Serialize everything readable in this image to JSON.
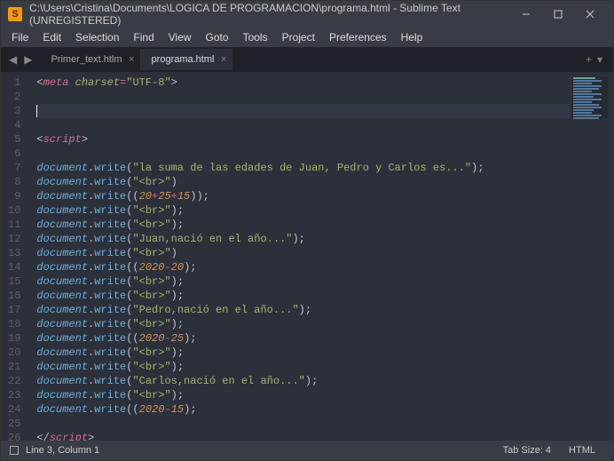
{
  "window": {
    "title": "C:\\Users\\Cristina\\Documents\\LOGICA DE PROGRAMACION\\programa.html - Sublime Text (UNREGISTERED)"
  },
  "menu": {
    "items": [
      "File",
      "Edit",
      "Selection",
      "Find",
      "View",
      "Goto",
      "Tools",
      "Project",
      "Preferences",
      "Help"
    ]
  },
  "tabs": {
    "items": [
      {
        "label": "Primer_text.htlm",
        "active": false
      },
      {
        "label": "programa.html",
        "active": true
      }
    ]
  },
  "code": {
    "lines": [
      {
        "n": 1,
        "seg": [
          {
            "c": "c-end",
            "t": "<"
          },
          {
            "c": "c-pink",
            "t": "meta"
          },
          {
            "c": "c-end",
            "t": " "
          },
          {
            "c": "c-attr",
            "t": "charset"
          },
          {
            "c": "c-eq",
            "t": "="
          },
          {
            "c": "c-str",
            "t": "\"UTF-8\""
          },
          {
            "c": "c-end",
            "t": ">"
          }
        ]
      },
      {
        "n": 2,
        "seg": []
      },
      {
        "n": 3,
        "seg": [],
        "current": true
      },
      {
        "n": 4,
        "seg": []
      },
      {
        "n": 5,
        "seg": [
          {
            "c": "c-end",
            "t": "<"
          },
          {
            "c": "c-pink",
            "t": "script"
          },
          {
            "c": "c-end",
            "t": ">"
          }
        ]
      },
      {
        "n": 6,
        "seg": []
      },
      {
        "n": 7,
        "seg": [
          {
            "c": "c-obj",
            "t": "document"
          },
          {
            "c": "c-dot",
            "t": "."
          },
          {
            "c": "c-fn",
            "t": "write"
          },
          {
            "c": "c-par",
            "t": "("
          },
          {
            "c": "c-str",
            "t": "\"la suma de las edades de Juan, Pedro y Carlos es...\""
          },
          {
            "c": "c-par",
            "t": ")"
          },
          {
            "c": "c-end",
            "t": ";"
          }
        ]
      },
      {
        "n": 8,
        "seg": [
          {
            "c": "c-obj",
            "t": "document"
          },
          {
            "c": "c-dot",
            "t": "."
          },
          {
            "c": "c-fn",
            "t": "write"
          },
          {
            "c": "c-par",
            "t": "("
          },
          {
            "c": "c-str",
            "t": "\"<br>\""
          },
          {
            "c": "c-par",
            "t": ")"
          }
        ]
      },
      {
        "n": 9,
        "seg": [
          {
            "c": "c-obj",
            "t": "document"
          },
          {
            "c": "c-dot",
            "t": "."
          },
          {
            "c": "c-fn",
            "t": "write"
          },
          {
            "c": "c-par",
            "t": "(("
          },
          {
            "c": "c-num",
            "t": "20"
          },
          {
            "c": "c-op",
            "t": "+"
          },
          {
            "c": "c-num",
            "t": "25"
          },
          {
            "c": "c-op",
            "t": "+"
          },
          {
            "c": "c-num",
            "t": "15"
          },
          {
            "c": "c-par",
            "t": "))"
          },
          {
            "c": "c-end",
            "t": ";"
          }
        ]
      },
      {
        "n": 10,
        "seg": [
          {
            "c": "c-obj",
            "t": "document"
          },
          {
            "c": "c-dot",
            "t": "."
          },
          {
            "c": "c-fn",
            "t": "write"
          },
          {
            "c": "c-par",
            "t": "("
          },
          {
            "c": "c-str",
            "t": "\"<br>\""
          },
          {
            "c": "c-par",
            "t": ")"
          },
          {
            "c": "c-end",
            "t": ";"
          }
        ]
      },
      {
        "n": 11,
        "seg": [
          {
            "c": "c-obj",
            "t": "document"
          },
          {
            "c": "c-dot",
            "t": "."
          },
          {
            "c": "c-fn",
            "t": "write"
          },
          {
            "c": "c-par",
            "t": "("
          },
          {
            "c": "c-str",
            "t": "\"<br>\""
          },
          {
            "c": "c-par",
            "t": ")"
          },
          {
            "c": "c-end",
            "t": ";"
          }
        ]
      },
      {
        "n": 12,
        "seg": [
          {
            "c": "c-obj",
            "t": "document"
          },
          {
            "c": "c-dot",
            "t": "."
          },
          {
            "c": "c-fn",
            "t": "write"
          },
          {
            "c": "c-par",
            "t": "("
          },
          {
            "c": "c-str",
            "t": "\"Juan,nació en el año...\""
          },
          {
            "c": "c-par",
            "t": ")"
          },
          {
            "c": "c-end",
            "t": ";"
          }
        ]
      },
      {
        "n": 13,
        "seg": [
          {
            "c": "c-obj",
            "t": "document"
          },
          {
            "c": "c-dot",
            "t": "."
          },
          {
            "c": "c-fn",
            "t": "write"
          },
          {
            "c": "c-par",
            "t": "("
          },
          {
            "c": "c-str",
            "t": "\"<br>\""
          },
          {
            "c": "c-par",
            "t": ")"
          }
        ]
      },
      {
        "n": 14,
        "seg": [
          {
            "c": "c-obj",
            "t": "document"
          },
          {
            "c": "c-dot",
            "t": "."
          },
          {
            "c": "c-fn",
            "t": "write"
          },
          {
            "c": "c-par",
            "t": "(("
          },
          {
            "c": "c-num",
            "t": "2020"
          },
          {
            "c": "c-op",
            "t": "-"
          },
          {
            "c": "c-num",
            "t": "20"
          },
          {
            "c": "c-par",
            "t": ")"
          },
          {
            "c": "c-end",
            "t": ";"
          }
        ]
      },
      {
        "n": 15,
        "seg": [
          {
            "c": "c-obj",
            "t": "document"
          },
          {
            "c": "c-dot",
            "t": "."
          },
          {
            "c": "c-fn",
            "t": "write"
          },
          {
            "c": "c-par",
            "t": "("
          },
          {
            "c": "c-str",
            "t": "\"<br>\""
          },
          {
            "c": "c-par",
            "t": ")"
          },
          {
            "c": "c-end",
            "t": ";"
          }
        ]
      },
      {
        "n": 16,
        "seg": [
          {
            "c": "c-obj",
            "t": "document"
          },
          {
            "c": "c-dot",
            "t": "."
          },
          {
            "c": "c-fn",
            "t": "write"
          },
          {
            "c": "c-par",
            "t": "("
          },
          {
            "c": "c-str",
            "t": "\"<br>\""
          },
          {
            "c": "c-par",
            "t": ")"
          },
          {
            "c": "c-end",
            "t": ";"
          }
        ]
      },
      {
        "n": 17,
        "seg": [
          {
            "c": "c-obj",
            "t": "document"
          },
          {
            "c": "c-dot",
            "t": "."
          },
          {
            "c": "c-fn",
            "t": "write"
          },
          {
            "c": "c-par",
            "t": "("
          },
          {
            "c": "c-str",
            "t": "\"Pedro,nació en el año...\""
          },
          {
            "c": "c-par",
            "t": ")"
          },
          {
            "c": "c-end",
            "t": ";"
          }
        ]
      },
      {
        "n": 18,
        "seg": [
          {
            "c": "c-obj",
            "t": "document"
          },
          {
            "c": "c-dot",
            "t": "."
          },
          {
            "c": "c-fn",
            "t": "write"
          },
          {
            "c": "c-par",
            "t": "("
          },
          {
            "c": "c-str",
            "t": "\"<br>\""
          },
          {
            "c": "c-par",
            "t": ")"
          },
          {
            "c": "c-end",
            "t": ";"
          }
        ]
      },
      {
        "n": 19,
        "seg": [
          {
            "c": "c-obj",
            "t": "document"
          },
          {
            "c": "c-dot",
            "t": "."
          },
          {
            "c": "c-fn",
            "t": "write"
          },
          {
            "c": "c-par",
            "t": "(("
          },
          {
            "c": "c-num",
            "t": "2020"
          },
          {
            "c": "c-op",
            "t": "-"
          },
          {
            "c": "c-num",
            "t": "25"
          },
          {
            "c": "c-par",
            "t": ")"
          },
          {
            "c": "c-end",
            "t": ";"
          }
        ]
      },
      {
        "n": 20,
        "seg": [
          {
            "c": "c-obj",
            "t": "document"
          },
          {
            "c": "c-dot",
            "t": "."
          },
          {
            "c": "c-fn",
            "t": "write"
          },
          {
            "c": "c-par",
            "t": "("
          },
          {
            "c": "c-str",
            "t": "\"<br>\""
          },
          {
            "c": "c-par",
            "t": ")"
          },
          {
            "c": "c-end",
            "t": ";"
          }
        ]
      },
      {
        "n": 21,
        "seg": [
          {
            "c": "c-obj",
            "t": "document"
          },
          {
            "c": "c-dot",
            "t": "."
          },
          {
            "c": "c-fn",
            "t": "write"
          },
          {
            "c": "c-par",
            "t": "("
          },
          {
            "c": "c-str",
            "t": "\"<br>\""
          },
          {
            "c": "c-par",
            "t": ")"
          },
          {
            "c": "c-end",
            "t": ";"
          }
        ]
      },
      {
        "n": 22,
        "seg": [
          {
            "c": "c-obj",
            "t": "document"
          },
          {
            "c": "c-dot",
            "t": "."
          },
          {
            "c": "c-fn",
            "t": "write"
          },
          {
            "c": "c-par",
            "t": "("
          },
          {
            "c": "c-str",
            "t": "\"Carlos,nació en el año...\""
          },
          {
            "c": "c-par",
            "t": ")"
          },
          {
            "c": "c-end",
            "t": ";"
          }
        ]
      },
      {
        "n": 23,
        "seg": [
          {
            "c": "c-obj",
            "t": "document"
          },
          {
            "c": "c-dot",
            "t": "."
          },
          {
            "c": "c-fn",
            "t": "write"
          },
          {
            "c": "c-par",
            "t": "("
          },
          {
            "c": "c-str",
            "t": "\"<br>\""
          },
          {
            "c": "c-par",
            "t": ")"
          },
          {
            "c": "c-end",
            "t": ";"
          }
        ]
      },
      {
        "n": 24,
        "seg": [
          {
            "c": "c-obj",
            "t": "document"
          },
          {
            "c": "c-dot",
            "t": "."
          },
          {
            "c": "c-fn",
            "t": "write"
          },
          {
            "c": "c-par",
            "t": "(("
          },
          {
            "c": "c-num",
            "t": "2020"
          },
          {
            "c": "c-op",
            "t": "-"
          },
          {
            "c": "c-num",
            "t": "15"
          },
          {
            "c": "c-par",
            "t": ")"
          },
          {
            "c": "c-end",
            "t": ";"
          }
        ]
      },
      {
        "n": 25,
        "seg": []
      },
      {
        "n": 26,
        "seg": [
          {
            "c": "c-end",
            "t": "</"
          },
          {
            "c": "c-pink",
            "t": "script"
          },
          {
            "c": "c-end",
            "t": ">"
          }
        ]
      }
    ]
  },
  "status": {
    "cursor": "Line 3, Column 1",
    "tabsize": "Tab Size: 4",
    "syntax": "HTML"
  }
}
